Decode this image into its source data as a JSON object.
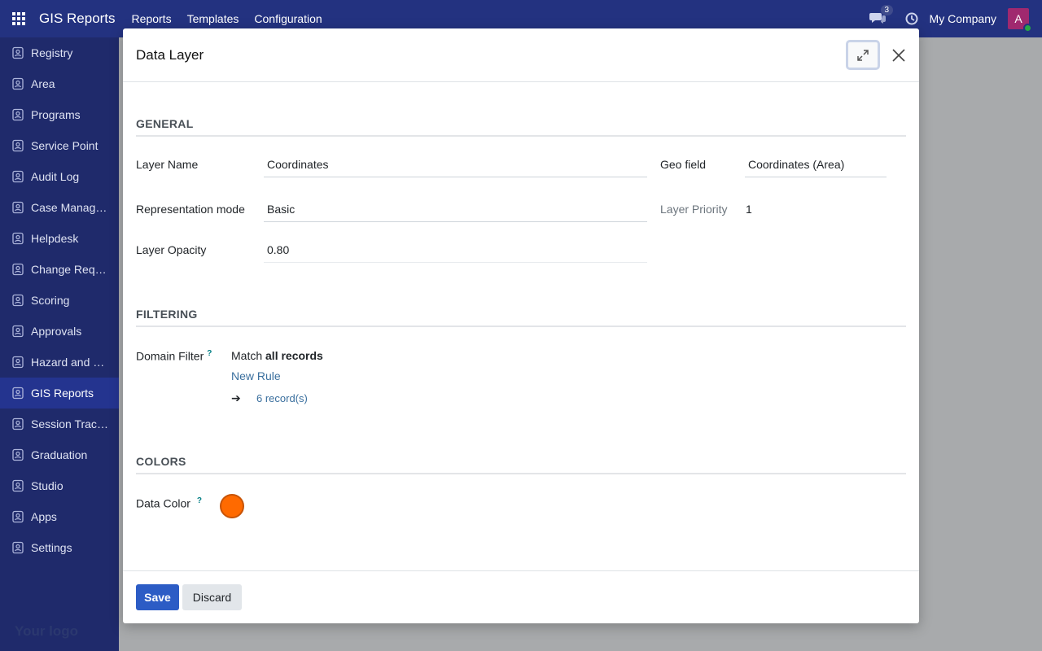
{
  "navbar": {
    "brand": "GIS Reports",
    "menu": [
      "Reports",
      "Templates",
      "Configuration"
    ],
    "chat_count": "3",
    "company": "My Company",
    "avatar_letter": "A"
  },
  "sidebar": {
    "items": [
      {
        "label": "Registry",
        "icon": "registry-icon"
      },
      {
        "label": "Area",
        "icon": "area-icon"
      },
      {
        "label": "Programs",
        "icon": "programs-icon"
      },
      {
        "label": "Service Point",
        "icon": "service-point-icon"
      },
      {
        "label": "Audit Log",
        "icon": "audit-log-icon"
      },
      {
        "label": "Case Management",
        "icon": "case-management-icon"
      },
      {
        "label": "Helpdesk",
        "icon": "headset-icon"
      },
      {
        "label": "Change Request",
        "icon": "change-request-icon"
      },
      {
        "label": "Scoring",
        "icon": "scoring-icon"
      },
      {
        "label": "Approvals",
        "icon": "approvals-icon"
      },
      {
        "label": "Hazard and Emergency",
        "icon": "hazard-icon"
      },
      {
        "label": "GIS Reports",
        "icon": "gis-reports-icon",
        "active": true
      },
      {
        "label": "Session Tracking",
        "icon": "session-tracking-icon"
      },
      {
        "label": "Graduation",
        "icon": "graduation-cap-icon"
      },
      {
        "label": "Studio",
        "icon": "studio-sliders-icon"
      },
      {
        "label": "Apps",
        "icon": "apps-icon"
      },
      {
        "label": "Settings",
        "icon": "gear-icon"
      }
    ],
    "logo_text": "Your logo"
  },
  "modal": {
    "title": "Data Layer",
    "general": {
      "section_title": "GENERAL",
      "layer_name_label": "Layer Name",
      "layer_name_value": "Coordinates",
      "geo_field_label": "Geo field",
      "geo_field_value": "Coordinates (Area)",
      "representation_label": "Representation mode",
      "representation_value": "Basic",
      "priority_label": "Layer Priority",
      "priority_value": "1",
      "opacity_label": "Layer Opacity",
      "opacity_value": "0.80"
    },
    "filtering": {
      "section_title": "FILTERING",
      "domain_label": "Domain Filter",
      "help": "?",
      "match_prefix": "Match",
      "match_bold": "all records",
      "new_rule": "New Rule",
      "arrow": "➔",
      "records": "6 record(s)"
    },
    "colors": {
      "section_title": "COLORS",
      "data_color_label": "Data Color",
      "help": "?",
      "color_hex": "#ff6a00"
    },
    "footer": {
      "save": "Save",
      "discard": "Discard"
    }
  },
  "colors": {
    "navbar": "#233280",
    "sidebar": "#1f2a6b",
    "primary_button": "#2c5cc5"
  }
}
